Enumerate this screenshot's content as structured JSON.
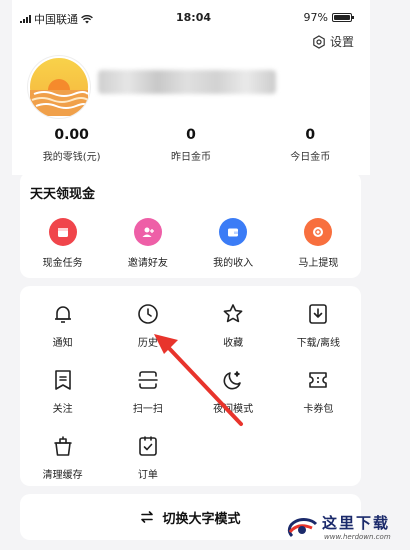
{
  "status_bar": {
    "carrier": "中国联通",
    "time": "18:04",
    "battery": "97%",
    "battery_level": 0.97
  },
  "header": {
    "settings_label": "设置"
  },
  "stats": [
    {
      "value": "0.00",
      "label": "我的零钱(元)"
    },
    {
      "value": "0",
      "label": "昨日金币"
    },
    {
      "value": "0",
      "label": "今日金币"
    }
  ],
  "cash": {
    "title": "天天领现金",
    "items": [
      {
        "label": "现金任务",
        "icon": "cash-task-icon",
        "color": "#f0454b"
      },
      {
        "label": "邀请好友",
        "icon": "invite-friend-icon",
        "color": "#ee5fa7"
      },
      {
        "label": "我的收入",
        "icon": "wallet-icon",
        "color": "#3b7cf6"
      },
      {
        "label": "马上提现",
        "icon": "withdraw-icon",
        "color": "#f86f3e"
      }
    ]
  },
  "tools": [
    {
      "label": "通知",
      "icon": "bell-icon"
    },
    {
      "label": "历史",
      "icon": "clock-icon"
    },
    {
      "label": "收藏",
      "icon": "star-icon"
    },
    {
      "label": "下载/离线",
      "icon": "download-icon"
    },
    {
      "label": "关注",
      "icon": "follow-icon"
    },
    {
      "label": "扫一扫",
      "icon": "scan-icon"
    },
    {
      "label": "夜间模式",
      "icon": "moon-icon"
    },
    {
      "label": "卡券包",
      "icon": "ticket-icon"
    },
    {
      "label": "清理缓存",
      "icon": "trash-icon"
    },
    {
      "label": "订单",
      "icon": "order-icon"
    }
  ],
  "bigfont": {
    "label": "切换大字模式",
    "icon": "switch-arrows-icon"
  },
  "watermark": {
    "title": "这里下载",
    "url": "www.herdown.com"
  },
  "colors": {
    "arrow": "#e8342c",
    "page_bg": "#f4f4f6",
    "card_bg": "#ffffff"
  }
}
